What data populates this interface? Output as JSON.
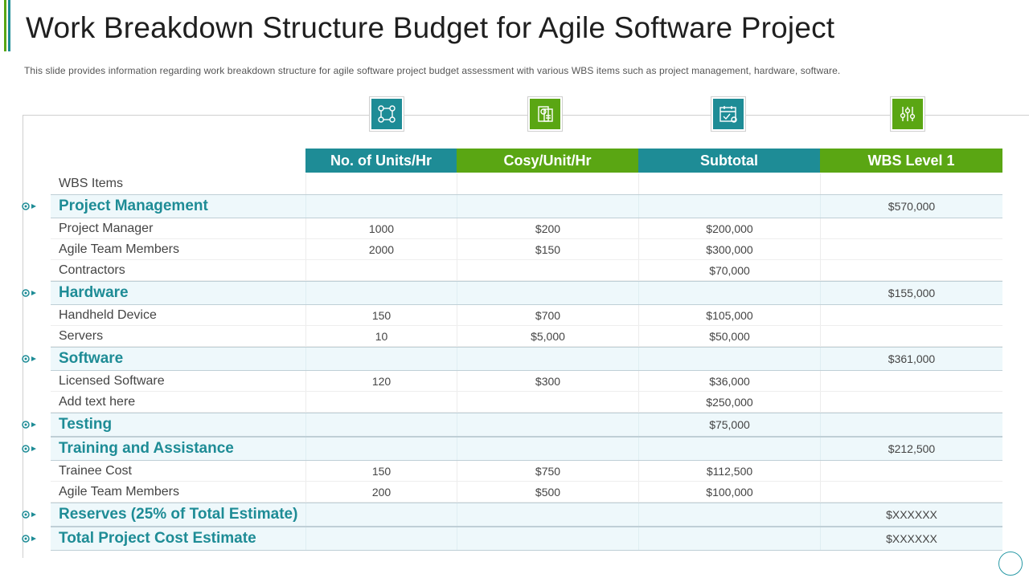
{
  "colors": {
    "teal": "#1e8c96",
    "green": "#5aa613",
    "dark_green": "#2e7d32"
  },
  "header": {
    "title": "Work Breakdown Structure Budget for Agile Software Project",
    "subtitle": "This slide provides  information  regarding  work breakdown  structure for agile software  project budget assessment with various  WBS items such as project management,  hardware,  software."
  },
  "icons": [
    "network-icon",
    "budget-document-icon",
    "calendar-check-icon",
    "settings-sliders-icon"
  ],
  "columns": [
    "No. of Units/Hr",
    "Cosy/Unit/Hr",
    "Subtotal",
    "WBS Level 1"
  ],
  "wbs_label": "WBS Items",
  "rows": [
    {
      "type": "section",
      "label": "Project Management",
      "units": "",
      "cost": "",
      "subtotal": "",
      "level1": "$570,000"
    },
    {
      "type": "item",
      "label": "Project Manager",
      "units": "1000",
      "cost": "$200",
      "subtotal": "$200,000",
      "level1": ""
    },
    {
      "type": "item",
      "label": "Agile Team Members",
      "units": "2000",
      "cost": "$150",
      "subtotal": "$300,000",
      "level1": ""
    },
    {
      "type": "item",
      "label": "Contractors",
      "units": "",
      "cost": "",
      "subtotal": "$70,000",
      "level1": ""
    },
    {
      "type": "section",
      "label": "Hardware",
      "units": "",
      "cost": "",
      "subtotal": "",
      "level1": "$155,000"
    },
    {
      "type": "item",
      "label": "Handheld Device",
      "units": "150",
      "cost": "$700",
      "subtotal": "$105,000",
      "level1": ""
    },
    {
      "type": "item",
      "label": "Servers",
      "units": "10",
      "cost": "$5,000",
      "subtotal": "$50,000",
      "level1": ""
    },
    {
      "type": "section",
      "label": "Software",
      "units": "",
      "cost": "",
      "subtotal": "",
      "level1": "$361,000"
    },
    {
      "type": "item",
      "label": "Licensed Software",
      "units": "120",
      "cost": "$300",
      "subtotal": "$36,000",
      "level1": ""
    },
    {
      "type": "item",
      "label": "Add text here",
      "units": "",
      "cost": "",
      "subtotal": "$250,000",
      "level1": ""
    },
    {
      "type": "section",
      "label": "Testing",
      "units": "",
      "cost": "",
      "subtotal": "$75,000",
      "level1": ""
    },
    {
      "type": "section",
      "label": "Training and Assistance",
      "units": "",
      "cost": "",
      "subtotal": "",
      "level1": "$212,500"
    },
    {
      "type": "item",
      "label": "Trainee Cost",
      "units": "150",
      "cost": "$750",
      "subtotal": "$112,500",
      "level1": ""
    },
    {
      "type": "item",
      "label": "Agile Team Members",
      "units": "200",
      "cost": "$500",
      "subtotal": "$100,000",
      "level1": ""
    },
    {
      "type": "section",
      "label": "Reserves (25% of Total Estimate)",
      "units": "",
      "cost": "",
      "subtotal": "",
      "level1": "$XXXXXX"
    },
    {
      "type": "section",
      "label": "Total Project Cost Estimate",
      "units": "",
      "cost": "",
      "subtotal": "",
      "level1": "$XXXXXX"
    }
  ]
}
